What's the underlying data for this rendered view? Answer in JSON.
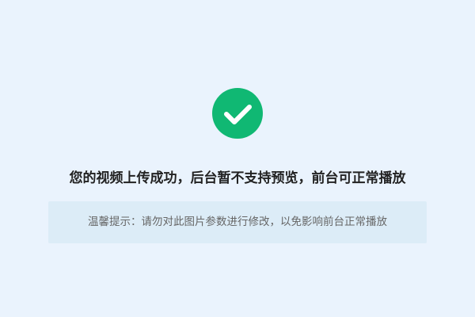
{
  "icon": {
    "name": "check-circle-icon",
    "color": "#10b873",
    "check_color": "#ffffff"
  },
  "message": {
    "title": "您的视频上传成功，后台暂不支持预览，前台可正常播放"
  },
  "tip": {
    "text": "温馨提示：请勿对此图片参数进行修改，以免影响前台正常播放"
  },
  "colors": {
    "background": "#eaf3fd",
    "tip_background": "#dcecf7",
    "title_text": "#222222",
    "tip_text": "#666666"
  }
}
